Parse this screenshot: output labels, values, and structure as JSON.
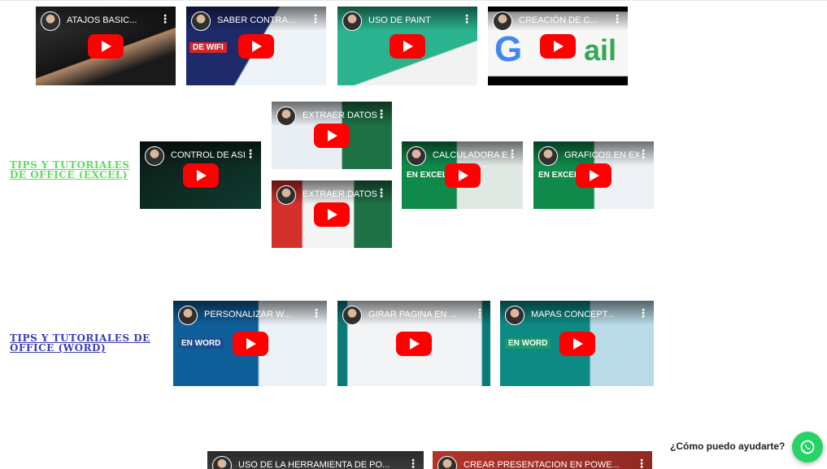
{
  "sections": {
    "excel_link": "TIPS Y TUTORIALES DE OFFICE (EXCEL)",
    "word_link": "TIPS Y TUTORIALES DE OFFICE (WORD)"
  },
  "videos": {
    "atajos": {
      "title": "ATAJOS BASIC..."
    },
    "wifi": {
      "title": "SABER CONTRA...",
      "overlay": "DE WIFI"
    },
    "paint": {
      "title": "USO DE PAINT"
    },
    "gmail": {
      "title": "CREACIÓN DE C..."
    },
    "extraer1": {
      "title": "EXTRAER DATOS ..."
    },
    "control": {
      "title": "CONTROL DE ASI..."
    },
    "extraer2": {
      "title": "EXTRAER DATOS ..."
    },
    "calculadora": {
      "title": "CALCULADORA E...",
      "overlay": "EN EXCEL"
    },
    "graficos": {
      "title": "GRAFICOS EN EX...",
      "overlay": "EN EXCEL"
    },
    "personalizar": {
      "title": "PERSONALIZAR W...",
      "overlay": "EN WORD"
    },
    "girar": {
      "title": "GIRAR PAGINA EN ..."
    },
    "mapas": {
      "title": "MAPAS CONCEPT...",
      "overlay": "EN WORD"
    },
    "herramienta": {
      "title": "USO DE LA HERRAMIENTA DE PO..."
    },
    "presentacion": {
      "title": "CREAR PRESENTACION EN POWE..."
    }
  },
  "chat": {
    "label": "¿Cómo puedo ayudarte?"
  },
  "icons": {
    "kebab": "⋮",
    "play": "play-icon",
    "whatsapp": "whatsapp-icon"
  }
}
